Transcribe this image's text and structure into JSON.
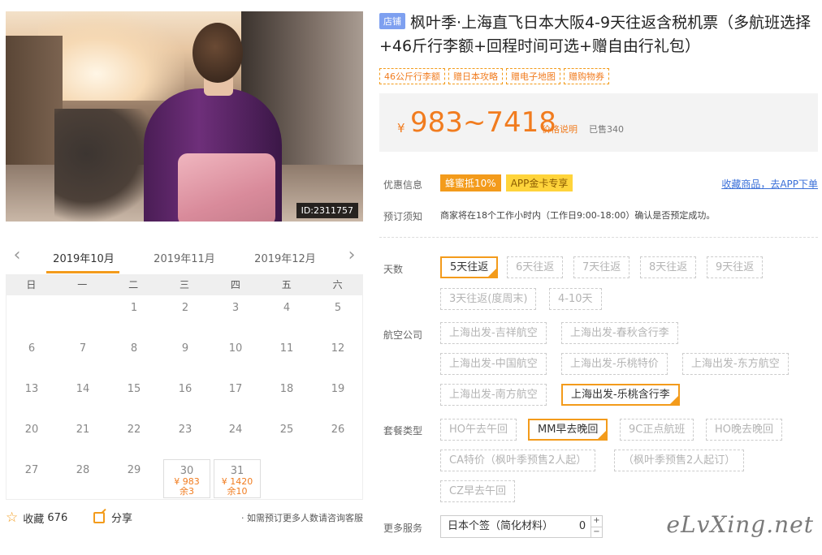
{
  "hero": {
    "id_badge": "ID:2311757"
  },
  "calendar": {
    "prev_icon": "chevron-left-icon",
    "next_icon": "chevron-right-icon",
    "months": [
      "2019年10月",
      "2019年11月",
      "2019年12月"
    ],
    "active_month": "2019年10月",
    "weekdays": [
      "日",
      "一",
      "二",
      "三",
      "四",
      "五",
      "六"
    ],
    "days": [
      [
        "",
        "",
        "1",
        "2",
        "3",
        "4",
        "5"
      ],
      [
        "6",
        "7",
        "8",
        "9",
        "10",
        "11",
        "12"
      ],
      [
        "13",
        "14",
        "15",
        "16",
        "17",
        "18",
        "19"
      ],
      [
        "20",
        "21",
        "22",
        "23",
        "24",
        "25",
        "26"
      ],
      [
        "27",
        "28",
        "29",
        "30",
        "31",
        "",
        ""
      ]
    ],
    "available": [
      {
        "day": "30",
        "price": "¥ 983",
        "left": "余3"
      },
      {
        "day": "31",
        "price": "¥ 1420",
        "left": "余10"
      }
    ]
  },
  "footer": {
    "favorite": "收藏",
    "favorite_count": "676",
    "share": "分享",
    "note": "· 如需预订更多人数请咨询客服"
  },
  "product": {
    "shop_tag": "店铺",
    "title": "枫叶季·上海直飞日本大阪4-9天往返含税机票（多航班选择+46斤行李额+回程时间可选+赠自由行礼包）",
    "tags": [
      "46公斤行李额",
      "赠日本攻略",
      "赠电子地图",
      "赠购物券"
    ]
  },
  "price": {
    "currency": "¥",
    "range": "983~7418",
    "explain": "价格说明",
    "sold": "已售340"
  },
  "promo": {
    "label": "优惠信息",
    "items": [
      "蜂蜜抵10%",
      "APP金卡专享"
    ],
    "app_link": "收藏商品，去APP下单"
  },
  "notice": {
    "label": "预订须知",
    "text": "商家将在18个工作小时内（工作日9:00-18:00）确认是否预定成功。"
  },
  "options": {
    "days": {
      "label": "天数",
      "items": [
        "5天往返",
        "6天往返",
        "7天往返",
        "8天往返",
        "9天往返",
        "3天往返(度周末)",
        "4-10天"
      ],
      "selected": "5天往返"
    },
    "airline": {
      "label": "航空公司",
      "items": [
        "上海出发-吉祥航空",
        "上海出发-春秋含行李",
        "上海出发-中国航空",
        "上海出发-乐桃特价",
        "上海出发-东方航空",
        "上海出发-南方航空",
        "上海出发-乐桃含行李"
      ],
      "selected": "上海出发-乐桃含行李"
    },
    "package": {
      "label": "套餐类型",
      "items": [
        "HO午去午回",
        "MM早去晚回",
        "9C正点航班",
        "HO晚去晚回",
        "CA特价（枫叶季预售2人起）",
        "（枫叶季预售2人起订）",
        "CZ早去午回"
      ],
      "selected": "MM早去晚回"
    },
    "services": {
      "label": "更多服务",
      "item": "日本个签（简化材料）",
      "quantity": "0",
      "plus": "+",
      "minus": "−"
    }
  },
  "watermark": "eLvXing.net"
}
